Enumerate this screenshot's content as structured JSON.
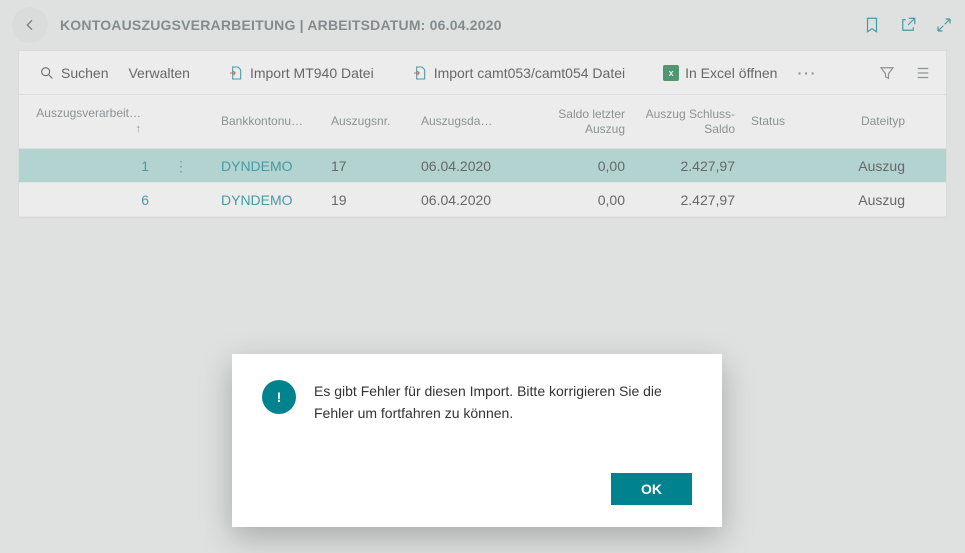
{
  "header": {
    "title": "KONTOAUSZUGSVERARBEITUNG | ARBEITSDATUM: 06.04.2020"
  },
  "toolbar": {
    "search": "Suchen",
    "manage": "Verwalten",
    "import_mt940": "Import MT940 Datei",
    "import_camt": "Import camt053/camt054 Datei",
    "open_excel": "In Excel öffnen"
  },
  "columns": {
    "c0": "Auszugsverarbeit…",
    "c1": "Bankkontonu…",
    "c2": "Auszugsnr.",
    "c3": "Auszugsda…",
    "c4": "Saldo letzter Auszug",
    "c5": "Auszug Schluss-Saldo",
    "c6": "Status",
    "c7": "Dateityp",
    "sort_arrow": "↑"
  },
  "rows": [
    {
      "id": "1",
      "bank": "DYNDEMO",
      "nr": "17",
      "date": "06.04.2020",
      "saldo_prev": "0,00",
      "saldo_close": "2.427,97",
      "status": "",
      "type": "Auszug"
    },
    {
      "id": "6",
      "bank": "DYNDEMO",
      "nr": "19",
      "date": "06.04.2020",
      "saldo_prev": "0,00",
      "saldo_close": "2.427,97",
      "status": "",
      "type": "Auszug"
    }
  ],
  "dialog": {
    "text": "Es gibt Fehler für diesen Import. Bitte korrigieren Sie die Fehler um fortfahren zu können.",
    "ok": "OK"
  }
}
